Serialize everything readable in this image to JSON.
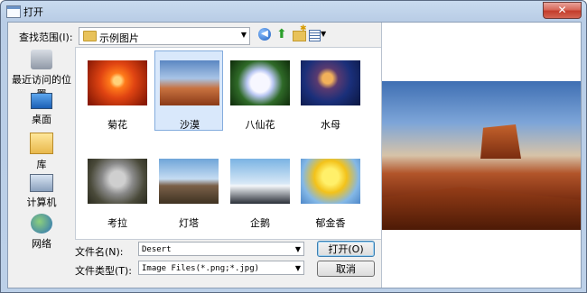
{
  "window": {
    "title": "打开",
    "close": "✕"
  },
  "toolbar": {
    "lookin_label": "查找范围(I):",
    "lookin_value": "示例图片"
  },
  "places": [
    {
      "label": "最近访问的位置"
    },
    {
      "label": "桌面"
    },
    {
      "label": "库"
    },
    {
      "label": "计算机"
    },
    {
      "label": "网络"
    }
  ],
  "files": [
    {
      "label": "菊花"
    },
    {
      "label": "沙漠",
      "selected": true
    },
    {
      "label": "八仙花"
    },
    {
      "label": "水母"
    },
    {
      "label": "考拉"
    },
    {
      "label": "灯塔"
    },
    {
      "label": "企鹅"
    },
    {
      "label": "郁金香"
    }
  ],
  "filename": {
    "label": "文件名(N):",
    "value": "Desert"
  },
  "filetype": {
    "label": "文件类型(T):",
    "value": "Image Files(*.png;*.jpg)"
  },
  "buttons": {
    "open": "打开(O)",
    "cancel": "取消"
  }
}
